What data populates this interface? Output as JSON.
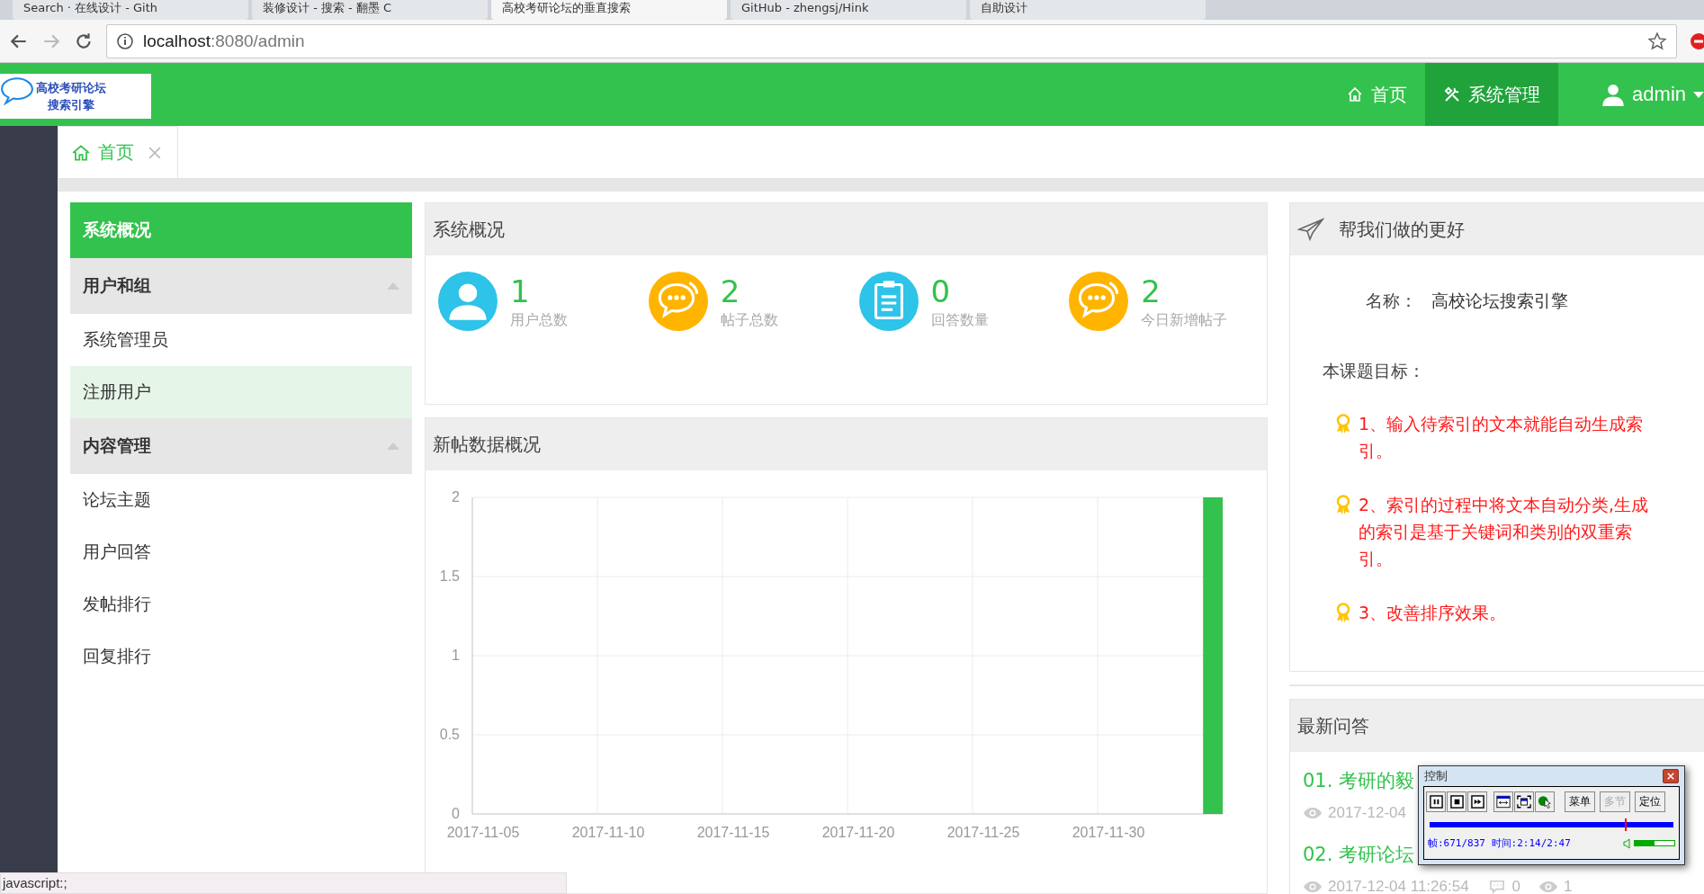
{
  "browser": {
    "tabs": [
      {
        "label": "Search · 在线设计 - Gith",
        "selected": false
      },
      {
        "label": "装修设计 - 搜索 - 翻墨 C",
        "selected": false
      },
      {
        "label": "高校考研论坛的垂直搜索",
        "selected": true
      },
      {
        "label": "GitHub - zhengsj/Hink",
        "selected": false
      },
      {
        "label": "自助设计",
        "selected": false
      }
    ],
    "address": {
      "host": "localhost",
      "path": ":8080/admin"
    }
  },
  "header": {
    "logo_text": [
      "高校考研论坛",
      "搜索引擎"
    ],
    "nav": [
      {
        "label": "首页",
        "selected": false
      },
      {
        "label": "系统管理",
        "selected": true
      }
    ],
    "user": "admin"
  },
  "page_tabs": [
    {
      "label": "首页",
      "selected": true
    }
  ],
  "sidebar": {
    "items": [
      {
        "kind": "item",
        "label": "系统概况",
        "selected": true
      },
      {
        "kind": "group",
        "label": "用户和组",
        "expanded": true,
        "children": [
          {
            "label": "系统管理员",
            "selected": false,
            "hovered": false
          },
          {
            "label": "注册用户",
            "selected": false,
            "hovered": true
          }
        ]
      },
      {
        "kind": "group",
        "label": "内容管理",
        "expanded": true,
        "children": [
          {
            "label": "论坛主题",
            "selected": false,
            "hovered": false
          },
          {
            "label": "用户回答",
            "selected": false,
            "hovered": false
          },
          {
            "label": "发帖排行",
            "selected": false,
            "hovered": false
          },
          {
            "label": "回复排行",
            "selected": false,
            "hovered": false
          }
        ]
      }
    ]
  },
  "overview": {
    "title": "系统概况",
    "stats": [
      {
        "value": "1",
        "label": "用户总数",
        "color": "#2ec3e8"
      },
      {
        "value": "2",
        "label": "帖子总数",
        "color": "#ffb400"
      },
      {
        "value": "0",
        "label": "回答数量",
        "color": "#2ec3e8"
      },
      {
        "value": "2",
        "label": "今日新增帖子",
        "color": "#ffb400"
      }
    ]
  },
  "chart_panel": {
    "title": "新帖数据概况",
    "chart_data": {
      "type": "bar",
      "grid": true,
      "categories": [
        "2017-11-05",
        null,
        null,
        null,
        null,
        "2017-11-10",
        null,
        null,
        null,
        null,
        "2017-11-15",
        null,
        null,
        null,
        null,
        "2017-11-20",
        null,
        null,
        null,
        null,
        "2017-11-25",
        null,
        null,
        null,
        null,
        "2017-11-30",
        null,
        null,
        null,
        null
      ],
      "series": [
        {
          "color": "#33c24d",
          "values": [
            0,
            0,
            0,
            0,
            0,
            0,
            0,
            0,
            0,
            0,
            0,
            0,
            0,
            0,
            0,
            0,
            0,
            0,
            0,
            0,
            0,
            0,
            0,
            0,
            0,
            0,
            0,
            0,
            0,
            2
          ]
        }
      ],
      "ylim": [
        0,
        2
      ],
      "yticks": [
        0,
        {
          "value": 0.5,
          "label": "0.5"
        },
        1,
        {
          "value": 1.5,
          "label": "1.5"
        },
        2
      ]
    }
  },
  "feedback": {
    "title": "帮我们做的更好",
    "name_label": "名称：",
    "name": "高校论坛搜索引擎",
    "goals_label": "本课题目标：",
    "goals": [
      "1、输入待索引的文本就能自动生成索引。",
      "2、索引的过程中将文本自动分类,生成的索引是基于关键词和类别的双重索引。",
      "3、改善排序效果。"
    ]
  },
  "latest": {
    "title": "最新问答",
    "items": [
      {
        "title": "01. 考研的毅",
        "meta": [
          {
            "kind": "date",
            "text": "2017-12-04"
          }
        ]
      },
      {
        "title": "02. 考研论坛",
        "meta": [
          {
            "kind": "date",
            "text": "2017-12-04 11:26:54"
          },
          {
            "kind": "comments",
            "text": "0"
          },
          {
            "kind": "views",
            "text": "1"
          }
        ]
      }
    ]
  },
  "status_bar": "javascript:;",
  "recorder": {
    "title": "控制",
    "buttons": [
      {
        "label": "菜单",
        "disabled": false
      },
      {
        "label": "多节",
        "disabled": true
      },
      {
        "label": "定位",
        "disabled": false
      }
    ],
    "progress": {
      "level": 0.8
    },
    "status": "帧:671/837 时间:2:14/2:47",
    "volume": {
      "level": 0.49
    }
  }
}
